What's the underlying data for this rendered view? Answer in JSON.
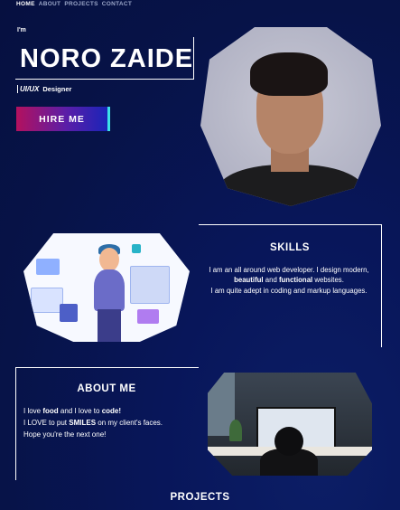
{
  "nav": {
    "items": [
      "HOME",
      "ABOUT",
      "PROJECTS",
      "CONTACT"
    ]
  },
  "hero": {
    "greeting": "I'm",
    "name": "NORO ZAIDE",
    "role_prefix": "UI/UX",
    "role_suffix": "Designer",
    "hire_label": "HIRE ME"
  },
  "skills": {
    "title": "SKILLS",
    "line1_a": "I am an all around web developer. I design modern, ",
    "line1_b": "beautiful",
    "line1_c": " and ",
    "line1_d": "functional",
    "line1_e": " websites.",
    "line2": "I am quite adept in coding and markup languages."
  },
  "about": {
    "title": "ABOUT ME",
    "l1_a": "I love ",
    "l1_b": "food",
    "l1_c": " and I love to ",
    "l1_d": "code!",
    "l2_a": "I LOVE to put ",
    "l2_b": "SMILES",
    "l2_c": " on my client's faces.",
    "l3": "Hope you're the next one!"
  },
  "projects": {
    "title": "PROJECTS"
  },
  "colors": {
    "accent_pink": "#b3115e",
    "accent_blue": "#1a24b8",
    "accent_cyan": "#3de0e8",
    "bg": "#08165a"
  }
}
